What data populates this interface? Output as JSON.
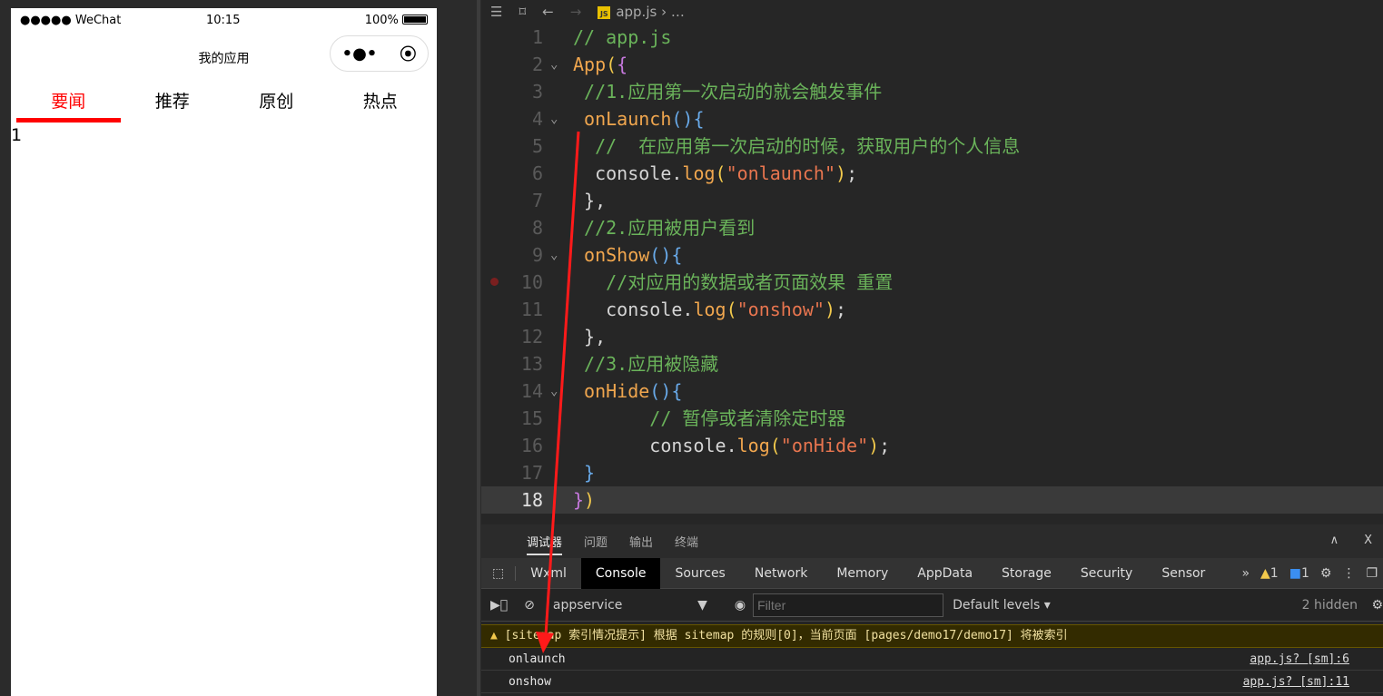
{
  "phone": {
    "signal": "●●●●● WeChat",
    "wifi_icon": "wifi-icon",
    "time": "10:15",
    "battery": "100%",
    "battery_level": 100,
    "title": "我的应用",
    "capsule_more": "•●•",
    "capsule_close": "⦿",
    "tabs": [
      {
        "label": "要闻",
        "active": true
      },
      {
        "label": "推荐"
      },
      {
        "label": "原创"
      },
      {
        "label": "热点"
      }
    ],
    "content": "1"
  },
  "editor": {
    "breadcrumb": {
      "file": "app.js",
      "more": "…",
      "js_badge": "JS"
    },
    "lines": [
      {
        "n": "1",
        "t": [
          [
            "// app.js",
            "c"
          ]
        ]
      },
      {
        "n": "2",
        "fold": true,
        "t": [
          [
            "App",
            "k"
          ],
          [
            "(",
            "y"
          ],
          [
            "{",
            "m"
          ]
        ]
      },
      {
        "n": "3",
        "t": [
          [
            " //1.应用第一次启动的就会触发事件",
            "c"
          ]
        ]
      },
      {
        "n": "4",
        "fold": true,
        "t": [
          [
            " onLaunch",
            "k"
          ],
          [
            "()",
            "p"
          ],
          [
            "{",
            "p"
          ]
        ]
      },
      {
        "n": "5",
        "t": [
          [
            "  //  在应用第一次启动的时候，获取用户的个人信息",
            "c"
          ]
        ]
      },
      {
        "n": "6",
        "t": [
          [
            "  console.",
            "d"
          ],
          [
            "log",
            "k"
          ],
          [
            "(",
            "y"
          ],
          [
            "\"onlaunch\"",
            "s"
          ],
          [
            ")",
            "y"
          ],
          [
            ";",
            "d"
          ]
        ]
      },
      {
        "n": "7",
        "t": [
          [
            " },",
            "d"
          ]
        ]
      },
      {
        "n": "8",
        "t": [
          [
            " //2.应用被用户看到",
            "c"
          ]
        ]
      },
      {
        "n": "9",
        "fold": true,
        "t": [
          [
            " onShow",
            "k"
          ],
          [
            "()",
            "p"
          ],
          [
            "{",
            "p"
          ]
        ]
      },
      {
        "n": "10",
        "bp": true,
        "t": [
          [
            "   //对应用的数据或者页面效果 重置",
            "c"
          ]
        ]
      },
      {
        "n": "11",
        "t": [
          [
            "   console.",
            "d"
          ],
          [
            "log",
            "k"
          ],
          [
            "(",
            "y"
          ],
          [
            "\"onshow\"",
            "s"
          ],
          [
            ")",
            "y"
          ],
          [
            ";",
            "d"
          ]
        ]
      },
      {
        "n": "12",
        "t": [
          [
            " },",
            "d"
          ]
        ]
      },
      {
        "n": "13",
        "t": [
          [
            " //3.应用被隐藏",
            "c"
          ]
        ]
      },
      {
        "n": "14",
        "fold": true,
        "t": [
          [
            " onHide",
            "k"
          ],
          [
            "()",
            "p"
          ],
          [
            "{",
            "p"
          ]
        ]
      },
      {
        "n": "15",
        "t": [
          [
            "       // 暂停或者清除定时器",
            "c"
          ]
        ]
      },
      {
        "n": "16",
        "t": [
          [
            "       console.",
            "d"
          ],
          [
            "log",
            "k"
          ],
          [
            "(",
            "y"
          ],
          [
            "\"onHide\"",
            "s"
          ],
          [
            ")",
            "y"
          ],
          [
            ";",
            "d"
          ]
        ]
      },
      {
        "n": "17",
        "t": [
          [
            " }",
            "p"
          ]
        ]
      },
      {
        "n": "18",
        "current": true,
        "t": [
          [
            "}",
            "m"
          ],
          [
            ")",
            "y"
          ]
        ]
      }
    ]
  },
  "devtools": {
    "top_tabs": [
      "调试器",
      "问题",
      "输出",
      "终端"
    ],
    "panels": [
      "Wxml",
      "Console",
      "Sources",
      "Network",
      "Memory",
      "AppData",
      "Storage",
      "Security",
      "Sensor"
    ],
    "active_panel": "Console",
    "more": "»",
    "warn_count": "1",
    "info_count": "1",
    "context": "appservice",
    "filter_placeholder": "Filter",
    "levels": "Default levels ▾",
    "hidden": "2 hidden",
    "messages": [
      {
        "type": "warning",
        "text": "[sitemap 索引情况提示] 根据 sitemap 的规则[0]，当前页面 [pages/demo17/demo17] 将被索引"
      },
      {
        "type": "log",
        "text": "onlaunch",
        "source": "app.js? [sm]:6"
      },
      {
        "type": "log",
        "text": "onshow",
        "source": "app.js? [sm]:11"
      }
    ]
  },
  "colors": {
    "accent": "#ff0000",
    "annotation_arrow": "#ff1a1a"
  }
}
